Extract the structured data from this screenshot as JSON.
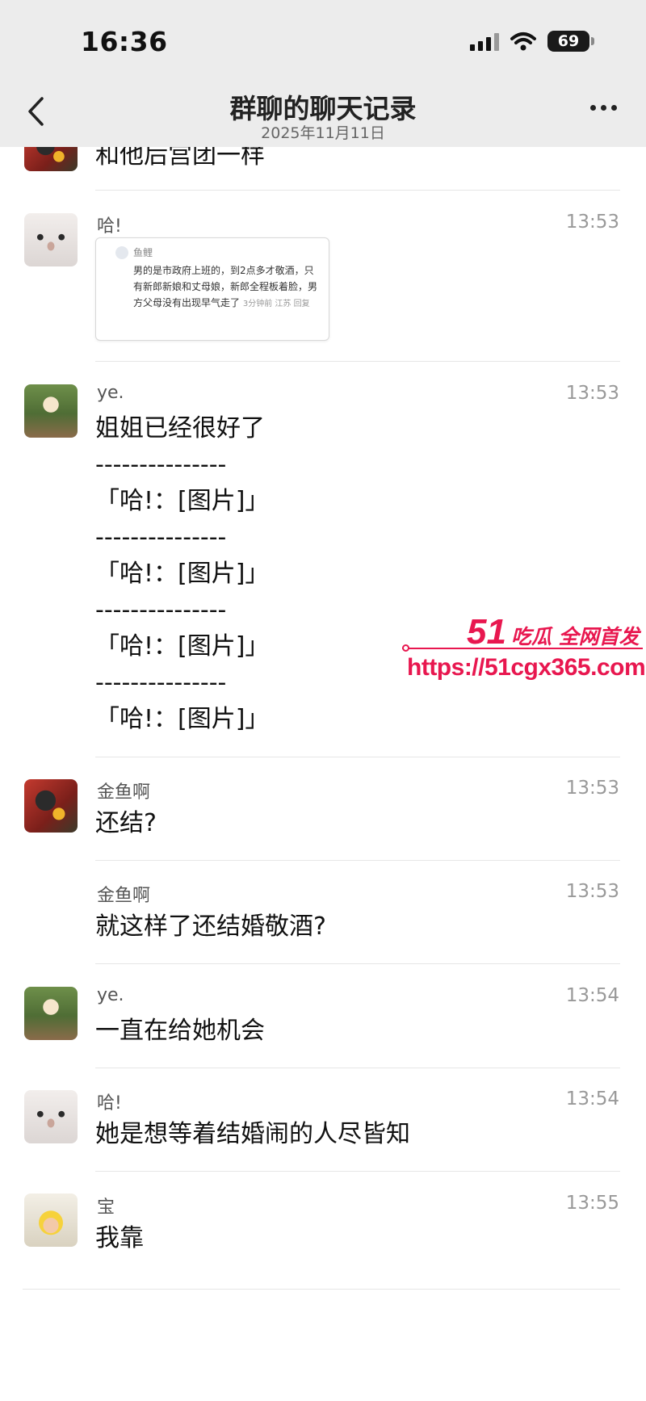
{
  "status_bar": {
    "time": "16:36",
    "battery": "69"
  },
  "header": {
    "title": "群聊的聊天记录",
    "date": "2025年11月11日"
  },
  "partial_message": {
    "text": "和他后宫团一样"
  },
  "messages": [
    {
      "sender": "哈!",
      "time": "13:53",
      "avatar": "cat-avatar",
      "card": {
        "name": "鱼鲤",
        "body": "男的是市政府上班的，到2点多才敬酒，只有新郎新娘和丈母娘，新郎全程板着脸，男方父母没有出现早气走了",
        "meta": "3分钟前 江苏  回复"
      }
    },
    {
      "sender": "ye.",
      "time": "13:53",
      "avatar": "girl-avatar",
      "lines": [
        "姐姐已经很好了",
        "---------------",
        "「哈!：[图片]」",
        "---------------",
        "「哈!：[图片]」",
        "---------------",
        "「哈!：[图片]」",
        "---------------",
        "「哈!：[图片]」"
      ]
    },
    {
      "sender": "金鱼啊",
      "time": "13:53",
      "avatar": "flower-avatar",
      "text": "还结?"
    },
    {
      "sender": "金鱼啊",
      "time": "13:53",
      "text": "就这样了还结婚敬酒?"
    },
    {
      "sender": "ye.",
      "time": "13:54",
      "avatar": "girl-avatar",
      "text": "一直在给她机会"
    },
    {
      "sender": "哈!",
      "time": "13:54",
      "avatar": "cat-avatar",
      "text": "她是想等着结婚闹的人尽皆知"
    },
    {
      "sender": "宝",
      "time": "13:55",
      "avatar": "baby-avatar",
      "text": "我靠"
    }
  ],
  "watermark": {
    "brand_num": "51",
    "brand_text": "吃瓜 全网首发",
    "url": "https://51cgx365.com"
  },
  "colors": {
    "header_bg": "#ececec",
    "watermark": "#e8174f",
    "time_gray": "#999999"
  }
}
